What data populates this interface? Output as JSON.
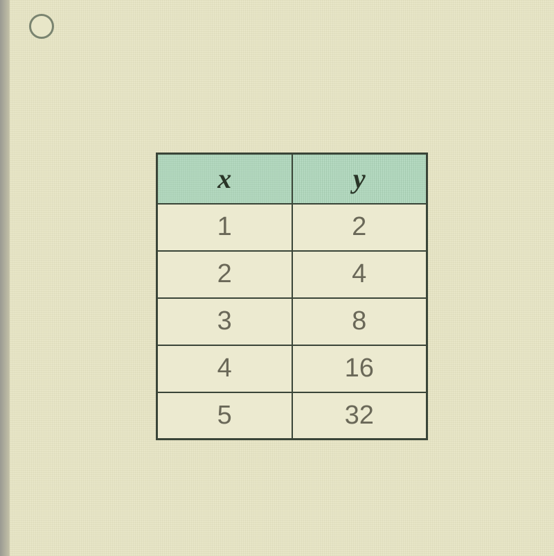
{
  "chart_data": {
    "type": "table",
    "headers": [
      "x",
      "y"
    ],
    "rows": [
      {
        "x": 1,
        "y": 2
      },
      {
        "x": 2,
        "y": 4
      },
      {
        "x": 3,
        "y": 8
      },
      {
        "x": 4,
        "y": 16
      },
      {
        "x": 5,
        "y": 32
      }
    ]
  }
}
